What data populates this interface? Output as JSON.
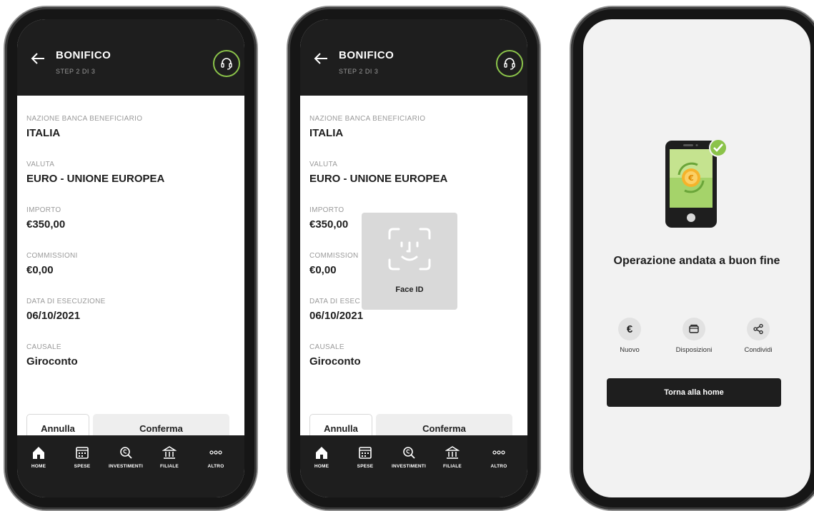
{
  "header": {
    "title": "BONIFICO",
    "step": "STEP 2 DI 3"
  },
  "fields": [
    {
      "label": "NAZIONE BANCA BENEFICIARIO",
      "value": "ITALIA"
    },
    {
      "label": "VALUTA",
      "value": "EURO - UNIONE EUROPEA"
    },
    {
      "label": "IMPORTO",
      "value": "€350,00"
    },
    {
      "label": "COMMISSIONI",
      "value": "€0,00"
    },
    {
      "label": "DATA DI ESECUZIONE",
      "value": "06/10/2021"
    },
    {
      "label": "CAUSALE",
      "value": "Giroconto"
    }
  ],
  "faceid_fields": [
    {
      "label": "COMMISSION"
    },
    {
      "label": "DATA DI ESEC"
    }
  ],
  "buttons": {
    "cancel": "Annulla",
    "confirm": "Conferma"
  },
  "tabs": [
    {
      "label": "HOME",
      "icon": "home-icon"
    },
    {
      "label": "SPESE",
      "icon": "calendar-icon"
    },
    {
      "label": "INVESTIMENTI",
      "icon": "investments-icon"
    },
    {
      "label": "FILIALE",
      "icon": "bank-icon"
    },
    {
      "label": "ALTRO",
      "icon": "more-icon"
    }
  ],
  "faceid": {
    "label": "Face ID"
  },
  "success": {
    "title": "Operazione andata a buon fine",
    "actions": [
      {
        "label": "Nuovo",
        "icon": "euro-icon",
        "glyph": "€"
      },
      {
        "label": "Disposizioni",
        "icon": "wallet-icon"
      },
      {
        "label": "Condividi",
        "icon": "share-icon"
      }
    ],
    "home_button": "Torna alla home"
  },
  "colors": {
    "accent": "#8bc34a",
    "dark": "#1e1e1e",
    "surface": "#ffffff",
    "muted": "#9a9a9a"
  }
}
